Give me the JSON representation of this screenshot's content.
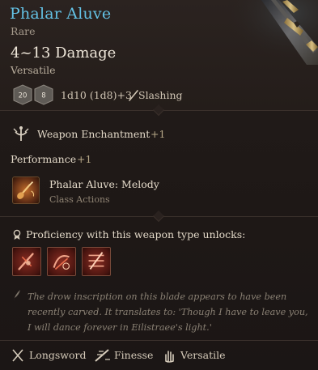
{
  "item": {
    "name": "Phalar Aluve",
    "rarity": "Rare",
    "damage": "4~13 Damage",
    "versatile_tag": "Versatile",
    "dice": {
      "left_die": "20",
      "right_die": "8",
      "formula": "1d10 (1d8)+3",
      "damage_type": "Slashing"
    }
  },
  "enchantment": {
    "label": "Weapon Enchantment",
    "bonus": "+1"
  },
  "performance": {
    "label": "Performance",
    "bonus": "+1"
  },
  "action": {
    "name": "Phalar Aluve: Melody",
    "category": "Class Actions",
    "icon": "lute-melody-icon"
  },
  "proficiency": {
    "label": "Proficiency with this weapon type unlocks:",
    "actions": [
      {
        "icon": "crippling-strike-icon"
      },
      {
        "icon": "flourish-icon"
      },
      {
        "icon": "slash-action-icon"
      }
    ]
  },
  "flavor_text": "The drow inscription on this blade appears to have been recently carved. It translates to: 'Though I have to leave you, I will dance forever in Eilistraee's light.'",
  "properties": [
    {
      "label": "Longsword",
      "icon": "crossed-swords-icon"
    },
    {
      "label": "Finesse",
      "icon": "finesse-icon"
    },
    {
      "label": "Versatile",
      "icon": "hand-icon"
    }
  ],
  "colors": {
    "name": "#63c1e4",
    "bonus": "#b7a888",
    "background": "#1b1716"
  }
}
